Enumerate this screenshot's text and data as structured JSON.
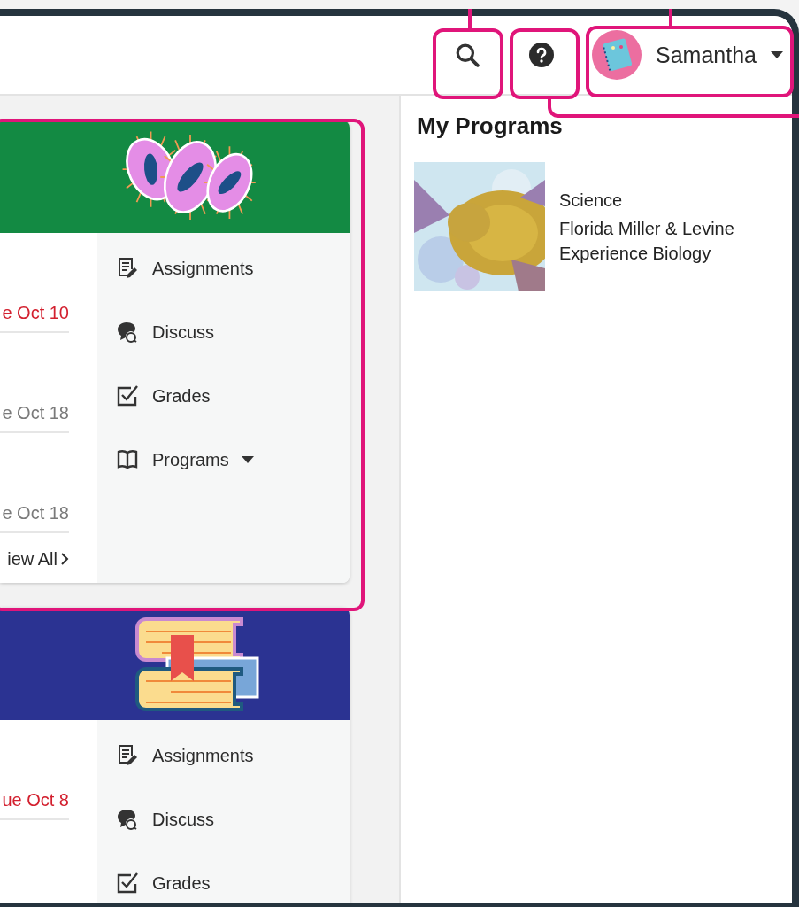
{
  "header": {
    "user_name": "Samantha"
  },
  "courses": [
    {
      "color": "#138a43",
      "kind": "bacteria",
      "due": [
        {
          "text": "e Oct 10",
          "overdue": true
        },
        {
          "text": "e Oct 18",
          "overdue": false
        },
        {
          "text": "e Oct 18",
          "overdue": false
        }
      ],
      "view_all": "iew All",
      "menu": [
        {
          "label": "Assignments",
          "kind": "assignments",
          "dropdown": false
        },
        {
          "label": "Discuss",
          "kind": "discuss",
          "dropdown": false
        },
        {
          "label": "Grades",
          "kind": "grades",
          "dropdown": false
        },
        {
          "label": "Programs",
          "kind": "programs",
          "dropdown": true
        }
      ]
    },
    {
      "color": "#2b3392",
      "kind": "books",
      "due": [
        {
          "text": "ue Oct 8",
          "overdue": true
        }
      ],
      "menu": [
        {
          "label": "Assignments",
          "kind": "assignments",
          "dropdown": false
        },
        {
          "label": "Discuss",
          "kind": "discuss",
          "dropdown": false
        },
        {
          "label": "Grades",
          "kind": "grades",
          "dropdown": false
        }
      ]
    }
  ],
  "programs": {
    "title": "My Programs",
    "items": [
      {
        "kind": "picture",
        "subject": "Science",
        "name": "Florida Miller & Levine Experience Biology"
      }
    ]
  }
}
